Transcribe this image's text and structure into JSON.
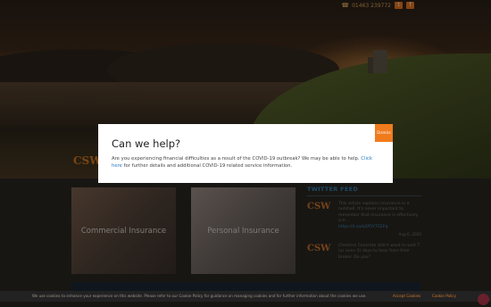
{
  "topbar": {
    "phone": "01463 239772",
    "social": [
      {
        "icon": "twitter-icon",
        "label": "t"
      },
      {
        "icon": "facebook-icon",
        "label": "f"
      }
    ]
  },
  "logo": {
    "text": "CSW"
  },
  "cards": [
    {
      "label": "Commercial Insurance"
    },
    {
      "label": "Personal Insurance"
    }
  ],
  "twitter": {
    "title": "TWITTER FEED",
    "tweets": [
      {
        "logo": "CSW",
        "text": "This article explains insurance in a nutshell. It's never important to remember that insurance is effectively a tr...",
        "link": "https://t.co/o2P5Y7CEFq",
        "date": "Aug 6, 2020"
      },
      {
        "logo": "CSW",
        "text": "Cheshire Concrete didn't want to wait 7 (or even 5) days to hear from their broker. Do you?",
        "link": "",
        "date": ""
      }
    ]
  },
  "modal": {
    "title": "Can we help?",
    "close_label": "Dismiss",
    "text_before": "Are you experiencing financial difficulties as a result of the COVID-19 outbreak? We may be able to help. ",
    "link_text": "Click here",
    "text_after": " for further details and additional COVID-19 related service information."
  },
  "cookie": {
    "text": "We use cookies to enhance your experience on this website. Please refer to our Cookie Policy for guidance on managing cookies and for further information about the cookies we use.",
    "accept_label": "Accept Cookies",
    "more_label": "Cookie Policy"
  },
  "colors": {
    "accent": "#f07b1d",
    "link": "#2778c4",
    "twitter_title": "#2e7fb3"
  }
}
